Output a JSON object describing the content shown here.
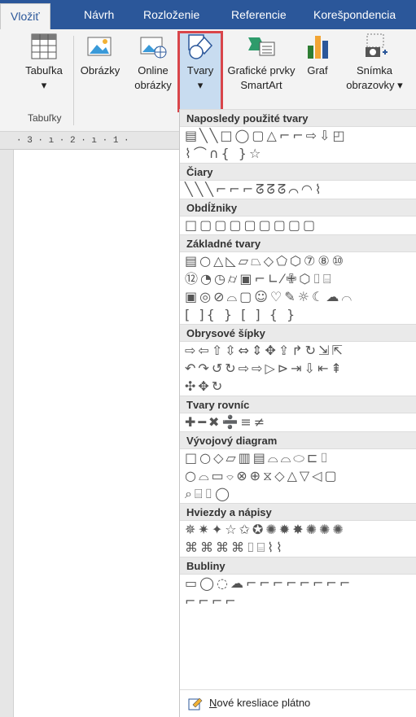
{
  "tabs": [
    "Vložiť",
    "Návrh",
    "Rozloženie",
    "Referencie",
    "Korešpondencia"
  ],
  "ribbon": {
    "buttons": [
      {
        "label": "Tabuľka",
        "sub": "▾"
      },
      {
        "label": "Obrázky",
        "sub": ""
      },
      {
        "label": "Online",
        "sub": "obrázky"
      },
      {
        "label": "Tvary",
        "sub": "▾"
      },
      {
        "label": "Grafické prvky",
        "sub": "SmartArt"
      },
      {
        "label": "Graf",
        "sub": ""
      },
      {
        "label": "Snímka",
        "sub": "obrazovky ▾"
      }
    ],
    "group_label": "Tabuľky"
  },
  "ruler": "· 3 · ı · 2 · ı · 1 ·",
  "gallery": {
    "sections": [
      {
        "title": "Naposledy použité tvary",
        "rows": [
          "▤╲╲□◯▢△⌐⌐⇨⇩◰",
          "⌇⌒∩{ }☆"
        ]
      },
      {
        "title": "Čiary",
        "rows": [
          "╲╲╲⌐⌐⌐ᘔᘔᘔ⌒◠⌇"
        ]
      },
      {
        "title": "Obdĺžniky",
        "rows": [
          "□▢▢▢▢▢▢▢▢"
        ]
      },
      {
        "title": "Základné tvary",
        "rows": [
          "▤○△◺▱⏢◇⬠⬡⑦⑧⑩",
          "⑫◔◷⌭▣⌐∟⁄✙⬡⌷⌸",
          "▣◎⊘⌓▢☺♡✎☼☾☁⌒",
          "[ ]{ } [  ]  {  }"
        ]
      },
      {
        "title": "Obrysové šípky",
        "rows": [
          "⇨⇦⇧⇳⇔⇕✥⇪↱↻⇲⇱",
          "↶↷↺↻⇨⇨▷⊳⇥⇩⇤⇞",
          "✣✥↻"
        ]
      },
      {
        "title": "Tvary rovníc",
        "rows": [
          "✚━✖➗≡≠"
        ]
      },
      {
        "title": "Vývojový diagram",
        "rows": [
          "□○◇▱▥▤⌓⌓⬭⊏⌷",
          "○⌓▭⌔⊗⊕⧖◇△▽◁▢",
          "⌕⌸⌷◯"
        ]
      },
      {
        "title": "Hviezdy a nápisy",
        "rows": [
          "✵✷✦☆✩✪✺✹✸✺✺✺",
          "⌘⌘⌘⌘⌷⌸⌇⌇"
        ]
      },
      {
        "title": "Bubliny",
        "rows": [
          "▭◯◌☁⌐⌐⌐⌐⌐⌐⌐⌐",
          "⌐⌐⌐⌐"
        ]
      }
    ],
    "footer": {
      "prefix": "N",
      "text": "ové kresliace plátno"
    }
  },
  "colors": {
    "accent": "#2b579a",
    "highlight": "#d9454a"
  }
}
